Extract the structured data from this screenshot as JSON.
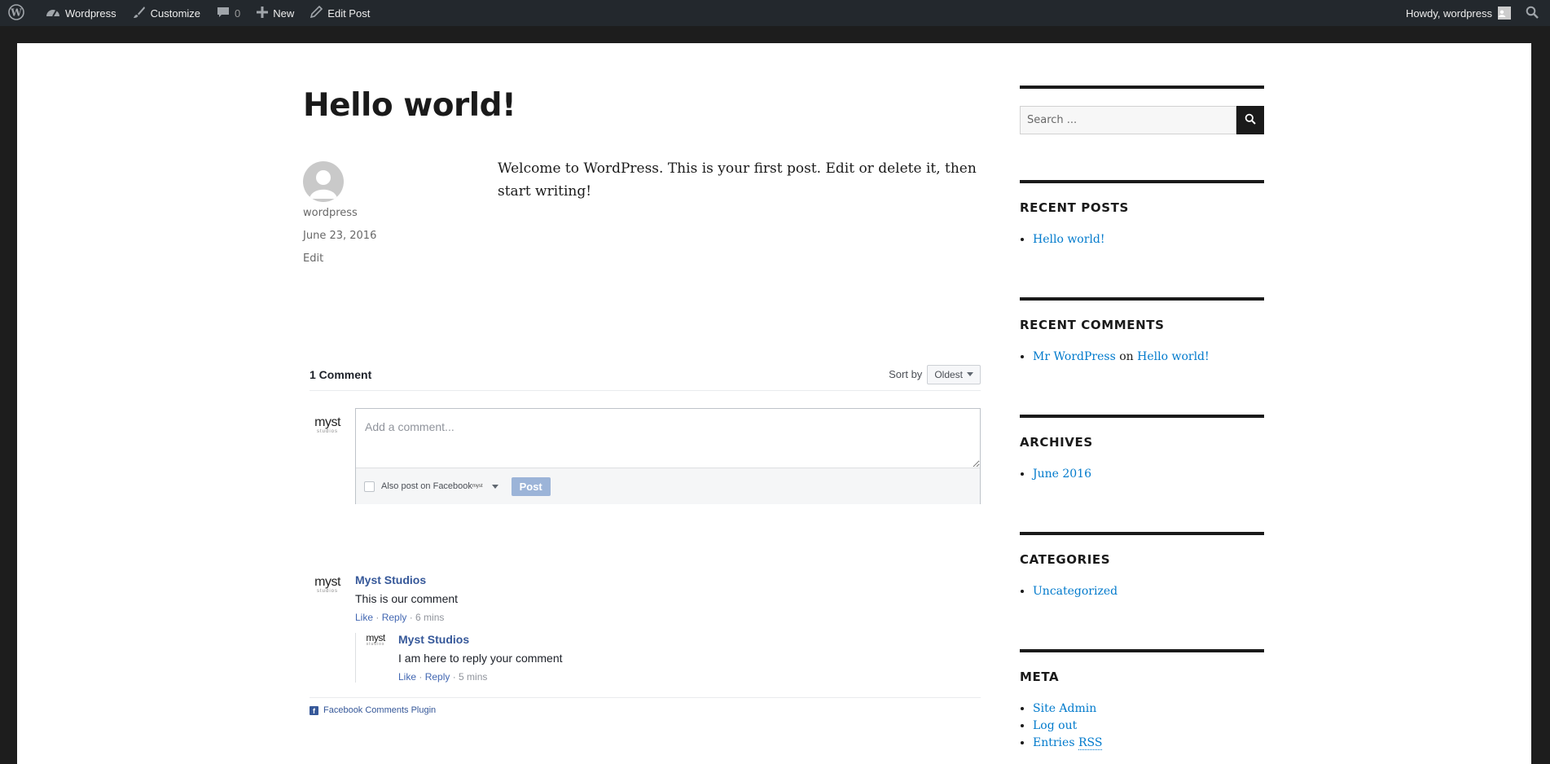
{
  "adminbar": {
    "site_name": "Wordpress",
    "customize": "Customize",
    "comments_count": "0",
    "new": "New",
    "edit_post": "Edit Post",
    "howdy": "Howdy, wordpress"
  },
  "post": {
    "title": "Hello world!",
    "author": "wordpress",
    "date": "June 23, 2016",
    "edit": "Edit",
    "content": "Welcome to WordPress. This is your first post. Edit or delete it, then start writing!"
  },
  "fb_comments": {
    "count_label": "1 Comment",
    "sort_label": "Sort by",
    "sort_value": "Oldest",
    "composer_placeholder": "Add a comment...",
    "also_post": "Also post on Facebook",
    "post_button": "Post",
    "logo_main": "myst",
    "logo_sub": "studios",
    "comments": [
      {
        "author": "Myst Studios",
        "text": "This is our comment",
        "like": "Like",
        "reply": "Reply",
        "time": "6 mins"
      },
      {
        "author": "Myst Studios",
        "text": "I am here to reply your comment",
        "like": "Like",
        "reply": "Reply",
        "time": "5 mins"
      }
    ],
    "plugin_label": "Facebook Comments Plugin"
  },
  "sidebar": {
    "search_placeholder": "Search ...",
    "recent_posts": {
      "title": "RECENT POSTS",
      "items": [
        "Hello world!"
      ]
    },
    "recent_comments": {
      "title": "RECENT COMMENTS",
      "author": "Mr WordPress",
      "on": "on",
      "post": "Hello world!"
    },
    "archives": {
      "title": "ARCHIVES",
      "items": [
        "June 2016"
      ]
    },
    "categories": {
      "title": "CATEGORIES",
      "items": [
        "Uncategorized"
      ]
    },
    "meta": {
      "title": "META",
      "items": [
        "Site Admin",
        "Log out"
      ],
      "entries_label": "Entries",
      "rss": "RSS"
    }
  },
  "colors": {
    "adminbar_bg": "#23282d",
    "link": "#007acc",
    "fb_blue": "#365899",
    "post_button": "#9cb4d8"
  }
}
